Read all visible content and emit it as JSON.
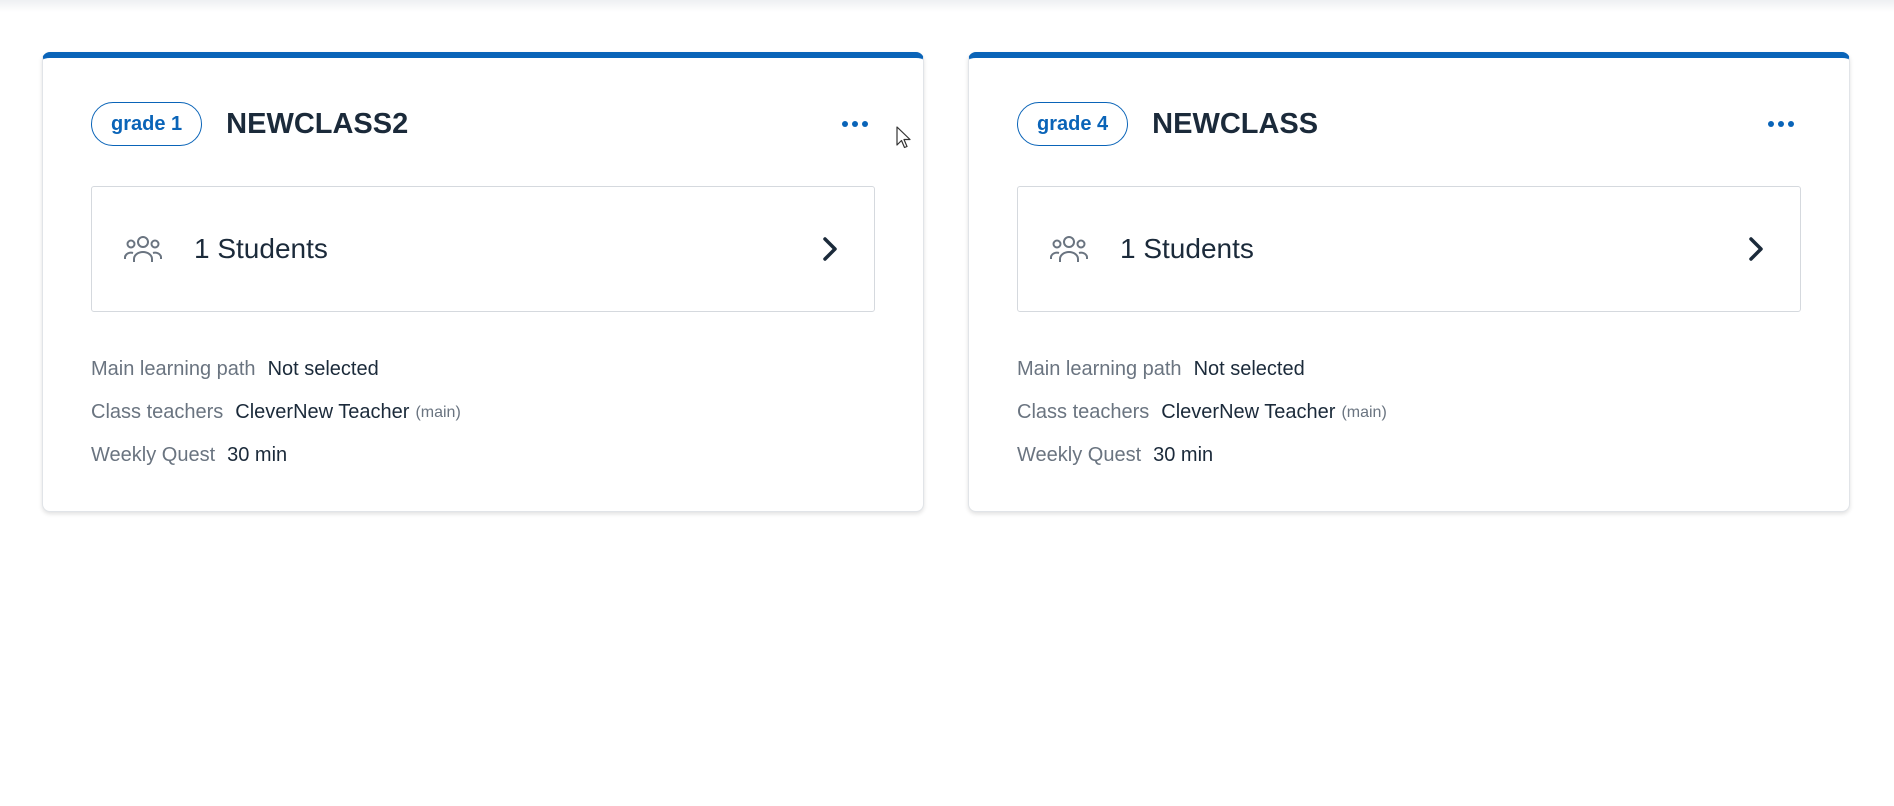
{
  "classes": [
    {
      "grade": "grade 1",
      "name": "NEWCLASS2",
      "students_label": "1 Students",
      "details": {
        "learning_path_key": "Main learning path",
        "learning_path_value": "Not selected",
        "teachers_key": "Class teachers",
        "teachers_value": "CleverNew Teacher",
        "teachers_role": "(main)",
        "weekly_quest_key": "Weekly Quest",
        "weekly_quest_value": "30 min"
      },
      "icons": {
        "menu": "more-horizontal-icon",
        "students": "people-group-icon",
        "open": "chevron-right-icon"
      }
    },
    {
      "grade": "grade 4",
      "name": "NEWCLASS",
      "students_label": "1 Students",
      "details": {
        "learning_path_key": "Main learning path",
        "learning_path_value": "Not selected",
        "teachers_key": "Class teachers",
        "teachers_value": "CleverNew Teacher",
        "teachers_role": "(main)",
        "weekly_quest_key": "Weekly Quest",
        "weekly_quest_value": "30 min"
      },
      "icons": {
        "menu": "more-horizontal-icon",
        "students": "people-group-icon",
        "open": "chevron-right-icon"
      }
    }
  ],
  "colors": {
    "accent": "#0a64b8",
    "text": "#1b2a3a",
    "muted": "#6a7480",
    "border": "#d5d9de"
  }
}
